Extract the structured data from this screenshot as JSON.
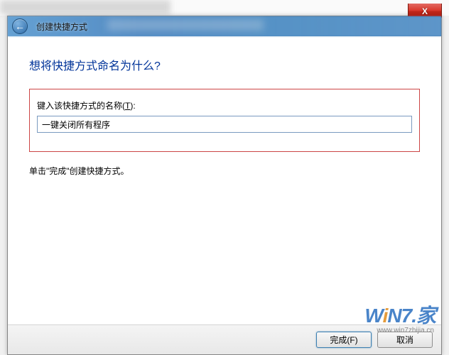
{
  "window": {
    "title": "创建快捷方式",
    "close_label": "X"
  },
  "content": {
    "heading": "想将快捷方式命名为什么?",
    "input_label_prefix": "键入该快捷方式的名称(",
    "input_label_hotkey": "T",
    "input_label_suffix": "):",
    "input_value": "一键关闭所有程序",
    "instruction": "单击\"完成\"创建快捷方式。"
  },
  "footer": {
    "finish_label": "完成(F)",
    "cancel_label": "取消"
  },
  "watermark": {
    "text_w": "W",
    "text_i": "i",
    "text_n": "N",
    "text_7": "7",
    "text_suffix": "家",
    "url": "www.win7zhijia.cn"
  }
}
